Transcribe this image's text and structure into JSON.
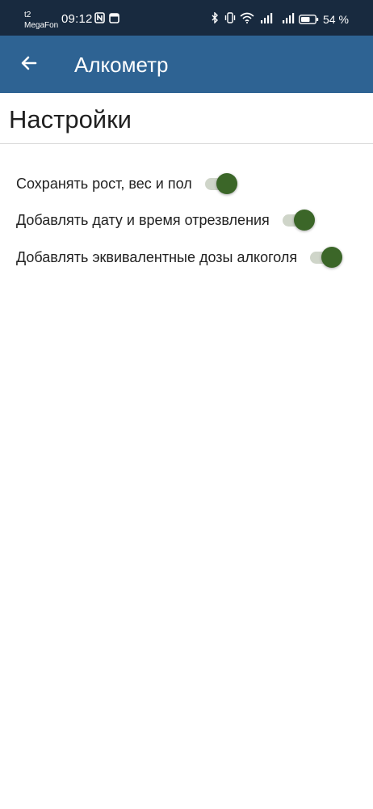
{
  "status_bar": {
    "carrier_1": "t2",
    "carrier_2": "MegaFon",
    "time": "09:12",
    "battery_percent": "54 %",
    "icons": [
      "nfc-icon",
      "calendar-icon",
      "bluetooth-icon",
      "vibrate-icon",
      "wifi-icon",
      "signal-icon",
      "signal-icon",
      "battery-icon"
    ]
  },
  "app_bar": {
    "title": "Алкометр",
    "back_icon": "arrow-back-icon",
    "color": "#2e6393"
  },
  "page": {
    "title": "Настройки"
  },
  "settings": [
    {
      "label": "Сохранять рост, вес и пол",
      "enabled": true
    },
    {
      "label": "Добавлять дату и время отрезвления",
      "enabled": true
    },
    {
      "label": "Добавлять эквивалентные дозы алкоголя",
      "enabled": true
    }
  ],
  "colors": {
    "status_bar": "#182a3f",
    "switch_thumb": "#3b6628",
    "switch_track": "#cfd5c9"
  }
}
